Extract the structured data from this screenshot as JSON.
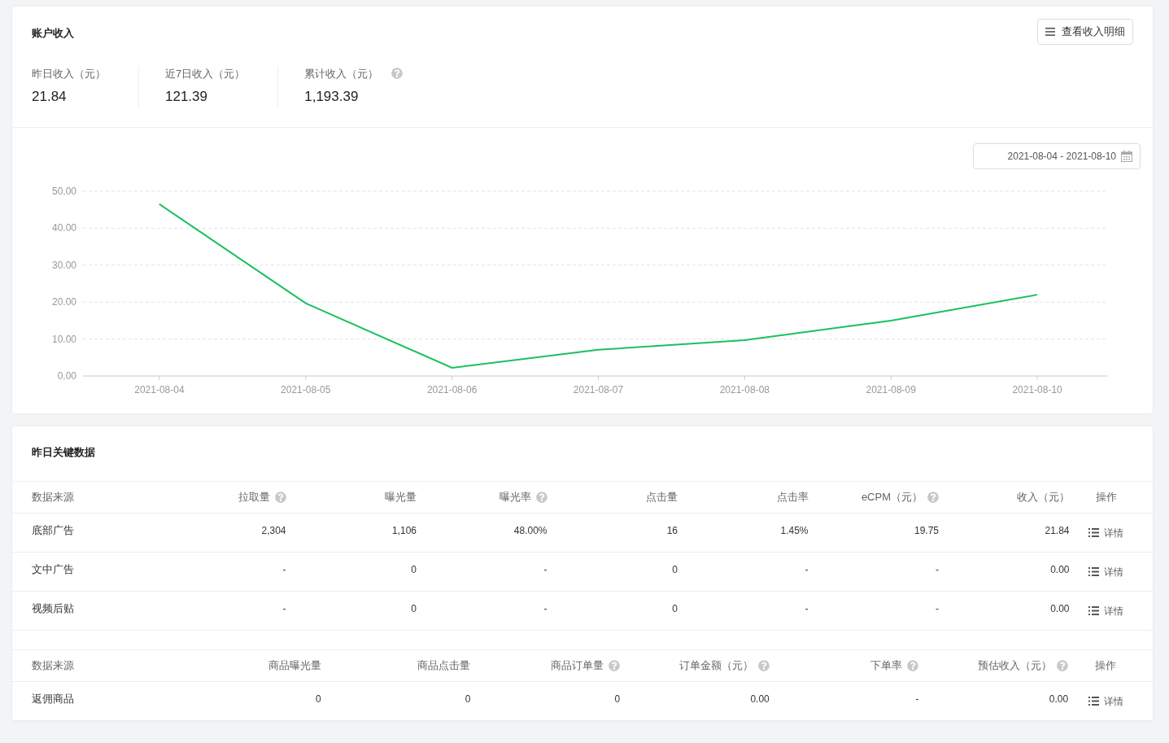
{
  "account_income": {
    "title": "账户收入",
    "detail_button": "查看收入明细",
    "stats": [
      {
        "label": "昨日收入（元）",
        "value": "21.84",
        "help": false
      },
      {
        "label": "近7日收入（元）",
        "value": "121.39",
        "help": false
      },
      {
        "label": "累计收入（元）",
        "value": "1,193.39",
        "help": true
      }
    ]
  },
  "trend": {
    "date_range": "2021-08-04 - 2021-08-10",
    "chart_data": {
      "type": "line",
      "categories": [
        "2021-08-04",
        "2021-08-05",
        "2021-08-06",
        "2021-08-07",
        "2021-08-08",
        "2021-08-09",
        "2021-08-10"
      ],
      "grid": true,
      "series": [
        {
          "color": "#19c15f",
          "values": [
            46.5,
            19.7,
            2.2,
            7.1,
            9.7,
            15.0,
            22.0
          ]
        }
      ],
      "ylim": [
        0,
        50
      ],
      "yticks": [
        {
          "value": 0,
          "label": "0.00"
        },
        {
          "value": 10,
          "label": "10.00"
        },
        {
          "value": 20,
          "label": "20.00"
        },
        {
          "value": 30,
          "label": "30.00"
        },
        {
          "value": 40,
          "label": "40.00"
        },
        {
          "value": 50,
          "label": "50.00"
        }
      ]
    }
  },
  "key_data": {
    "title": "昨日关键数据",
    "tables": [
      {
        "columns": [
          {
            "label": "数据来源",
            "help": false
          },
          {
            "label": "拉取量",
            "help": true
          },
          {
            "label": "曝光量",
            "help": false
          },
          {
            "label": "曝光率",
            "help": true
          },
          {
            "label": "点击量",
            "help": false
          },
          {
            "label": "点击率",
            "help": false
          },
          {
            "label": "eCPM（元）",
            "help": true
          },
          {
            "label": "收入（元）",
            "help": false
          },
          {
            "label": "操作",
            "help": false
          }
        ],
        "rows": [
          {
            "cells": [
              "底部广告",
              "2,304",
              "1,106",
              "48.00%",
              "16",
              "1.45%",
              "19.75",
              "21.84"
            ],
            "action": "详情"
          },
          {
            "cells": [
              "文中广告",
              "-",
              "0",
              "-",
              "0",
              "-",
              "-",
              "0.00"
            ],
            "action": "详情"
          },
          {
            "cells": [
              "视频后贴",
              "-",
              "0",
              "-",
              "0",
              "-",
              "-",
              "0.00"
            ],
            "action": "详情"
          }
        ]
      },
      {
        "columns": [
          {
            "label": "数据来源",
            "help": false
          },
          {
            "label": "商品曝光量",
            "help": false
          },
          {
            "label": "商品点击量",
            "help": false
          },
          {
            "label": "商品订单量",
            "help": true
          },
          {
            "label": "订单金额（元）",
            "help": true
          },
          {
            "label": "下单率",
            "help": true
          },
          {
            "label": "预估收入（元）",
            "help": true
          },
          {
            "label": "操作",
            "help": false
          }
        ],
        "rows": [
          {
            "cells": [
              "返佣商品",
              "0",
              "0",
              "0",
              "0.00",
              "-",
              "0.00"
            ],
            "action": "详情"
          }
        ]
      }
    ]
  }
}
